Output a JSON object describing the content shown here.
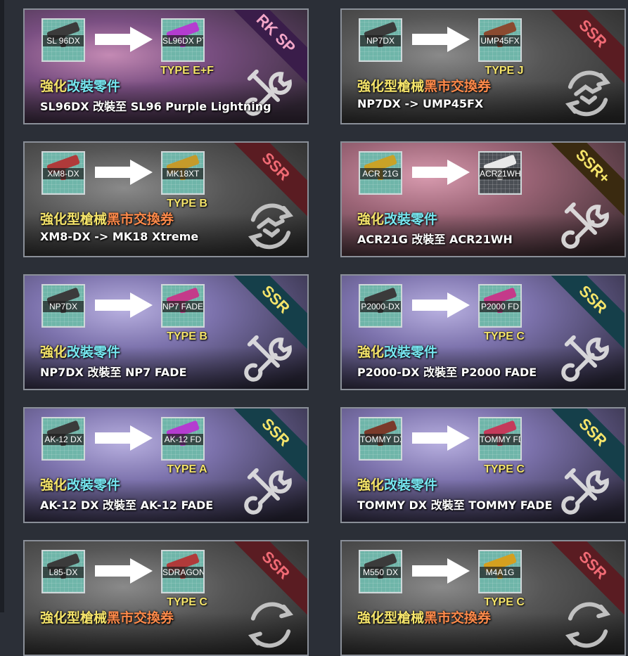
{
  "colors": {
    "type_tag": "#f5e46a",
    "title_yellow": "#f5e46a",
    "title_cyan": "#76e6f0",
    "title_orange": "#ff8a4a",
    "ribbon_rk": "#3a1d4a",
    "ribbon_ssr_red": "#5a1c22",
    "ribbon_ssr_teal": "#153f4a"
  },
  "cards": [
    {
      "badge": "RK SP",
      "src_label": "SL 96DX",
      "dst_label": "SL96DX PT",
      "type_tag": "TYPE E+F",
      "title_parts": [
        "強化",
        "改裝零件"
      ],
      "description": "SL96DX 改裝至 SL96 Purple Lightning",
      "icon": "wrench-icon",
      "src_gun_color": "#3b3b3b",
      "dst_gun_color": "#b43cd0"
    },
    {
      "badge": "SSR",
      "src_label": "NP7DX",
      "dst_label": "UMP45FX",
      "type_tag": "TYPE J",
      "title_parts": [
        "強化型槍械",
        "黑市交換券"
      ],
      "description": "NP7DX -> UMP45FX",
      "icon": "handshake-icon",
      "src_gun_color": "#3b3b3b",
      "dst_gun_color": "#8a4a30"
    },
    {
      "badge": "SSR",
      "src_label": "XM8-DX",
      "dst_label": "MK18XT",
      "type_tag": "TYPE B",
      "title_parts": [
        "強化型槍械",
        "黑市交換券"
      ],
      "description": "XM8-DX -> MK18 Xtreme",
      "icon": "handshake-icon",
      "src_gun_color": "#b03a3a",
      "dst_gun_color": "#c59a2a"
    },
    {
      "badge": "SSR+",
      "src_label": "ACR 21G",
      "dst_label": "ACR21WH",
      "type_tag": "",
      "title_parts": [
        "強化",
        "改裝零件"
      ],
      "description": "ACR21G 改裝至 ACR21WH",
      "icon": "wrench-icon",
      "src_gun_color": "#c9a227",
      "dst_gun_color": "#e8e8e8"
    },
    {
      "badge": "SSR",
      "src_label": "NP7DX",
      "dst_label": "NP7 FADE",
      "type_tag": "TYPE B",
      "title_parts": [
        "強化",
        "改裝零件"
      ],
      "description": "NP7DX 改裝至 NP7 FADE",
      "icon": "wrench-icon",
      "src_gun_color": "#3b3b3b",
      "dst_gun_color": "#c43a8a"
    },
    {
      "badge": "SSR",
      "src_label": "P2000-DX",
      "dst_label": "P2000 FD",
      "type_tag": "TYPE C",
      "title_parts": [
        "強化",
        "改裝零件"
      ],
      "description": "P2000-DX 改裝至 P2000 FADE",
      "icon": "wrench-icon",
      "src_gun_color": "#3b3b3b",
      "dst_gun_color": "#c43a8a"
    },
    {
      "badge": "SSR",
      "src_label": "AK-12 DX",
      "dst_label": "AK-12 FD",
      "type_tag": "TYPE A",
      "title_parts": [
        "強化",
        "改裝零件"
      ],
      "description": "AK-12 DX 改裝至 AK-12 FADE",
      "icon": "wrench-icon",
      "src_gun_color": "#3b3b3b",
      "dst_gun_color": "#b43cd0"
    },
    {
      "badge": "SSR",
      "src_label": "TOMMY DX",
      "dst_label": "TOMMY FD",
      "type_tag": "TYPE C",
      "title_parts": [
        "強化",
        "改裝零件"
      ],
      "description": "TOMMY DX 改裝至 TOMMY FADE",
      "icon": "wrench-icon",
      "src_gun_color": "#7a3a2a",
      "dst_gun_color": "#c43a5a"
    },
    {
      "badge": "SSR",
      "src_label": "L85-DX",
      "dst_label": "SDRAGON",
      "type_tag": "TYPE C",
      "title_parts": [
        "強化型槍械",
        "黑市交換券"
      ],
      "description": "",
      "icon": "handshake-icon",
      "src_gun_color": "#3b3b3b",
      "dst_gun_color": "#b03a3a"
    },
    {
      "badge": "SSR",
      "src_label": "M550 DX",
      "dst_label": "M4A1G",
      "type_tag": "TYPE C",
      "title_parts": [
        "強化型槍械",
        "黑市交換券"
      ],
      "description": "",
      "icon": "handshake-icon",
      "src_gun_color": "#3b3b3b",
      "dst_gun_color": "#d4a020"
    }
  ]
}
